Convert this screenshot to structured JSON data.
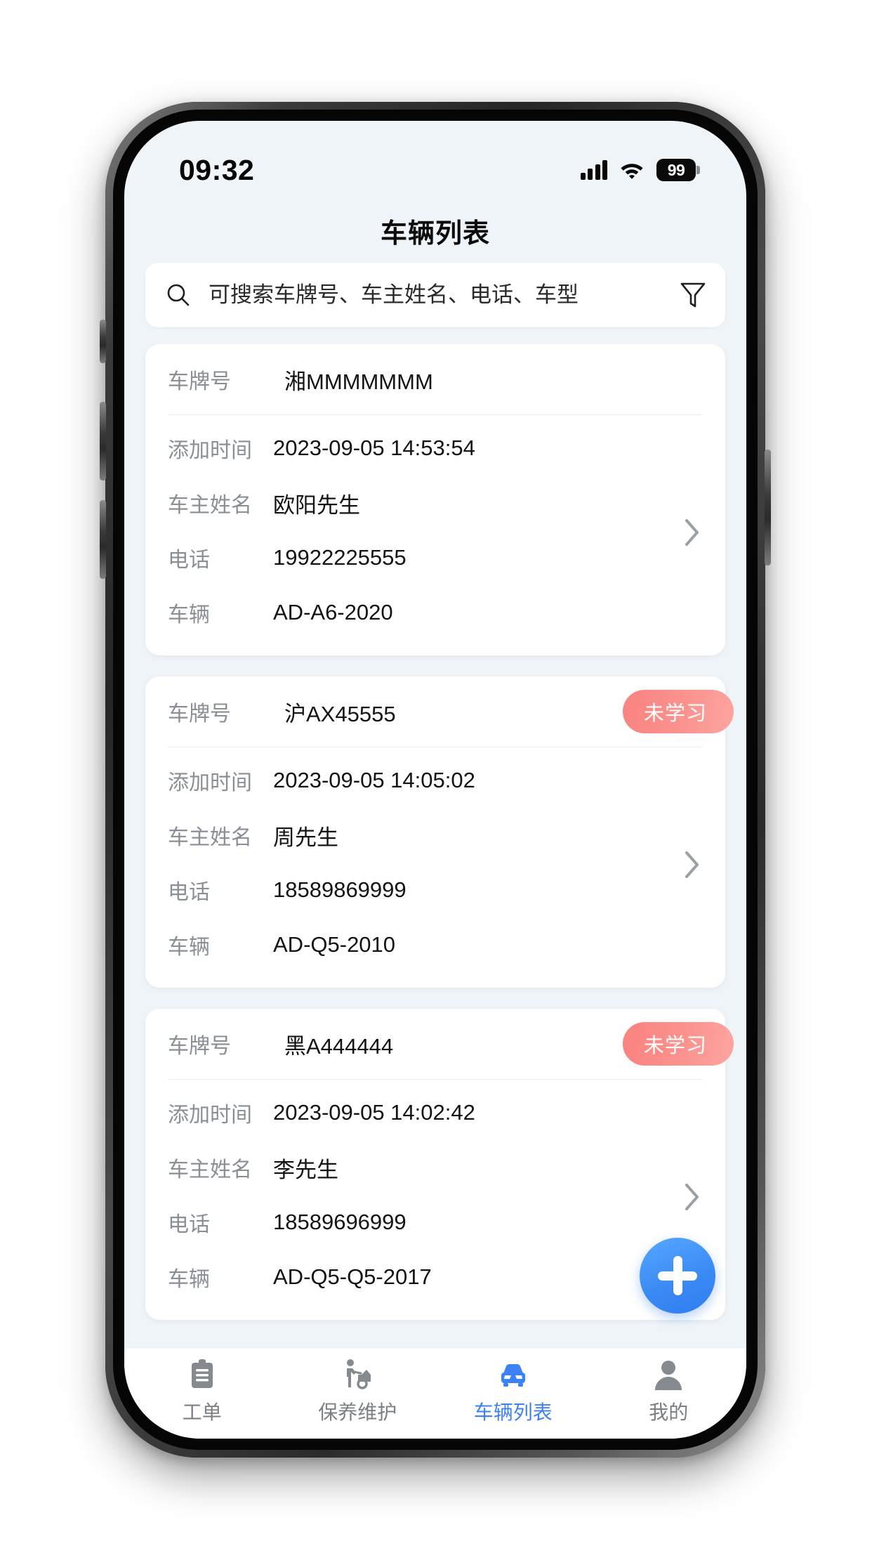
{
  "status_bar": {
    "time": "09:32",
    "battery_level": "99",
    "signal_icon": "signal-bars-icon",
    "wifi_icon": "wifi-icon",
    "battery_icon": "battery-icon"
  },
  "header": {
    "title": "车辆列表"
  },
  "search": {
    "placeholder": "可搜索车牌号、车主姓名、电话、车型",
    "value": "",
    "search_icon": "search-icon",
    "filter_icon": "filter-funnel-icon"
  },
  "labels": {
    "plate": "车牌号",
    "added_time": "添加时间",
    "owner_name": "车主姓名",
    "phone": "电话",
    "vehicle": "车辆"
  },
  "vehicles": [
    {
      "plate": "湘MMMMMMM",
      "added_time": "2023-09-05 14:53:54",
      "owner_name": "欧阳先生",
      "phone": "19922225555",
      "vehicle": "AD-A6-2020",
      "badge": ""
    },
    {
      "plate": "沪AX45555",
      "added_time": "2023-09-05 14:05:02",
      "owner_name": "周先生",
      "phone": "18589869999",
      "vehicle": "AD-Q5-2010",
      "badge": "未学习"
    },
    {
      "plate": "黑A444444",
      "added_time": "2023-09-05 14:02:42",
      "owner_name": "李先生",
      "phone": "18589696999",
      "vehicle": "AD-Q5-Q5-2017",
      "badge": "未学习"
    }
  ],
  "fab": {
    "label": "+",
    "icon": "plus-icon"
  },
  "tabbar": {
    "items": [
      {
        "label": "工单",
        "icon": "clipboard-icon",
        "active": false
      },
      {
        "label": "保养维护",
        "icon": "car-repair-icon",
        "active": false
      },
      {
        "label": "车辆列表",
        "icon": "car-icon",
        "active": true
      },
      {
        "label": "我的",
        "icon": "person-icon",
        "active": false
      }
    ]
  },
  "colors": {
    "accent_blue": "#3c82f6",
    "badge_pink": "#fb918d",
    "page_bg": "#eff4f8",
    "card_bg": "#ffffff",
    "label_gray": "#8a8f96"
  }
}
